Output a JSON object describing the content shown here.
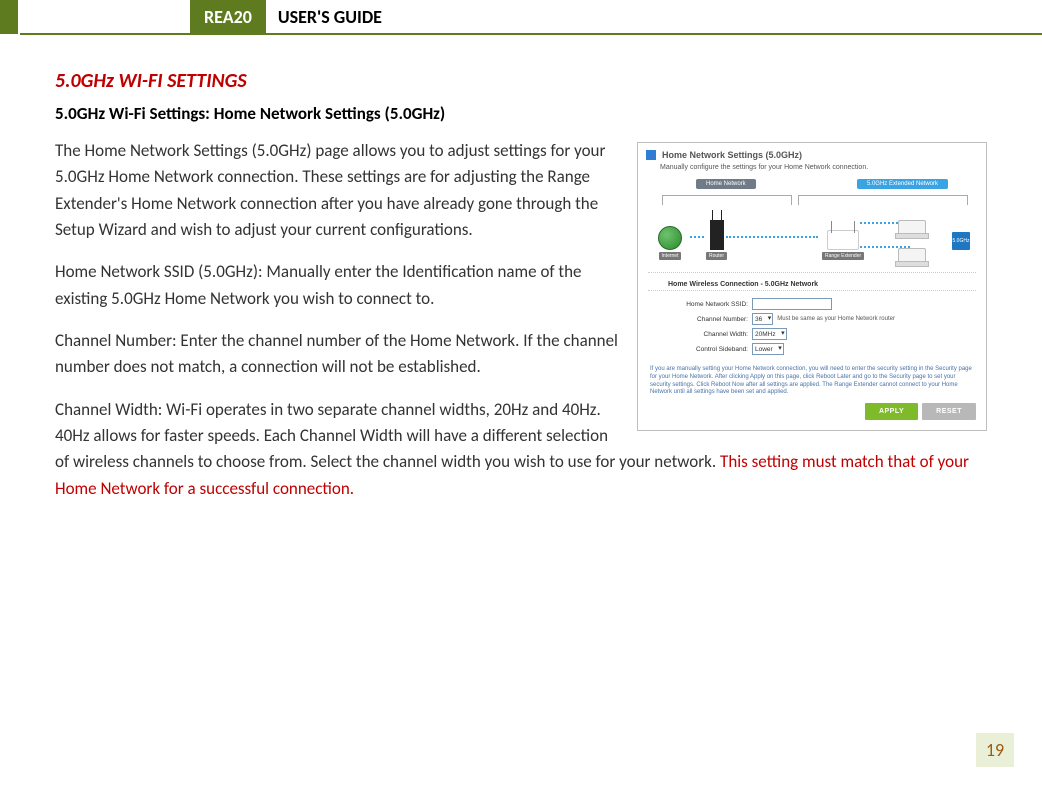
{
  "header": {
    "badge": "REA20",
    "title": "USER'S GUIDE"
  },
  "section_heading": "5.0GHz WI-FI SETTINGS",
  "subheading": "5.0GHz Wi-Fi Settings: Home Network Settings (5.0GHz)",
  "paragraphs": {
    "intro": "The Home Network Settings (5.0GHz) page allows you to adjust settings for your 5.0GHz Home Network connection. These settings are for adjusting the Range Extender's Home Network connection after you have already gone through the Setup Wizard and wish to adjust your current configurations.",
    "ssid": "Home Network SSID (5.0GHz): Manually enter the Identification name of the existing 5.0GHz Home Network you wish to connect to.",
    "channel_number": "Channel Number: Enter the channel number of the Home Network. If the channel number does not match, a connection will not be established.",
    "channel_width_main": "Channel Width: Wi-Fi operates in two separate channel widths, 20Hz and 40Hz. 40Hz allows for faster speeds. Each Channel Width will have a different selection of wireless channels to choose from. Select the channel width you wish to use for your network. ",
    "channel_width_warn": "This setting must match that of your Home Network for a successful connection."
  },
  "panel": {
    "title": "Home Network Settings (5.0GHz)",
    "subtitle": "Manually configure the settings for your Home Network connection.",
    "diagram": {
      "home_label": "Home Network",
      "ext_label": "5.0GHz Extended Network",
      "internet": "Internet",
      "router": "Router",
      "extender": "Range Extender",
      "badge": "5.0GHz"
    },
    "section": "Home Wireless Connection - 5.0GHz Network",
    "fields": {
      "ssid_label": "Home Network SSID:",
      "ssid_value": "",
      "chnum_label": "Channel Number:",
      "chnum_value": "36",
      "chnum_hint": "Must be same as your Home Network router",
      "chwidth_label": "Channel Width:",
      "chwidth_value": "20MHz",
      "sideband_label": "Control Sideband:",
      "sideband_value": "Lower"
    },
    "note": "If you are manually setting your Home Network connection, you will need to enter the security setting in the Security page for your Home Network. After clicking Apply on this page, click Reboot Later and go to the Security page to set your security settings. Click Reboot Now after all settings are applied. The Range Extender cannot connect to your Home Network until all settings have been set and applied.",
    "buttons": {
      "apply": "APPLY",
      "reset": "RESET"
    }
  },
  "page_number": "19"
}
